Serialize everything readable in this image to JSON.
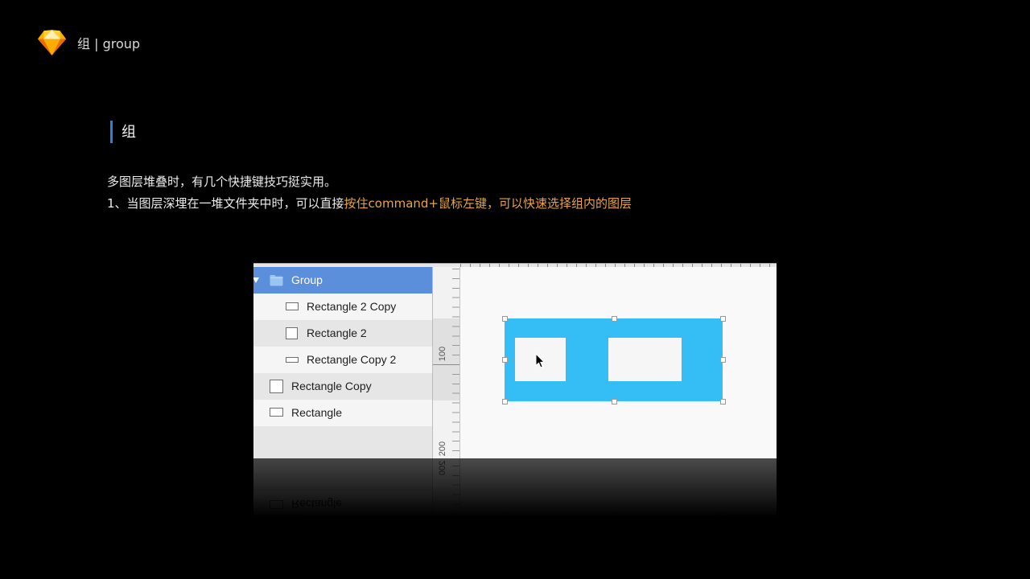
{
  "header": {
    "logo_icon": "sketch-logo-icon",
    "title": "组 | group"
  },
  "section": {
    "heading": "组"
  },
  "body": {
    "line1": "多图层堆叠时，有几个快捷键技巧挺实用。",
    "line2_prefix": "1、当图层深埋在一堆文件夹中时，可以直接",
    "line2_highlight": "按住command+鼠标左键，可以快速选择组内的图层"
  },
  "colors": {
    "background": "#000000",
    "accent": "#2f7fd8",
    "highlight": "#e9a640",
    "layer_selection": "#5b8edb",
    "shape_fill": "#35bdf6"
  },
  "sketch_screenshot": {
    "layers": [
      {
        "label": "Group",
        "icon": "folder-icon",
        "depth": 0,
        "selected": true,
        "expanded": true
      },
      {
        "label": "Rectangle 2 Copy",
        "icon": "rectangle-icon",
        "depth": 1,
        "selected": false
      },
      {
        "label": "Rectangle 2",
        "icon": "rectangle-icon",
        "depth": 1,
        "selected": false
      },
      {
        "label": "Rectangle Copy 2",
        "icon": "rectangle-icon",
        "depth": 1,
        "selected": false
      },
      {
        "label": "Rectangle Copy",
        "icon": "rectangle-icon",
        "depth": 0,
        "selected": false
      },
      {
        "label": "Rectangle",
        "icon": "rectangle-icon",
        "depth": 0,
        "selected": false
      }
    ],
    "ruler_labels": [
      "100",
      "200"
    ],
    "canvas": {
      "cursor_icon": "arrow-cursor-icon",
      "handle_icon": "resize-handle"
    }
  }
}
